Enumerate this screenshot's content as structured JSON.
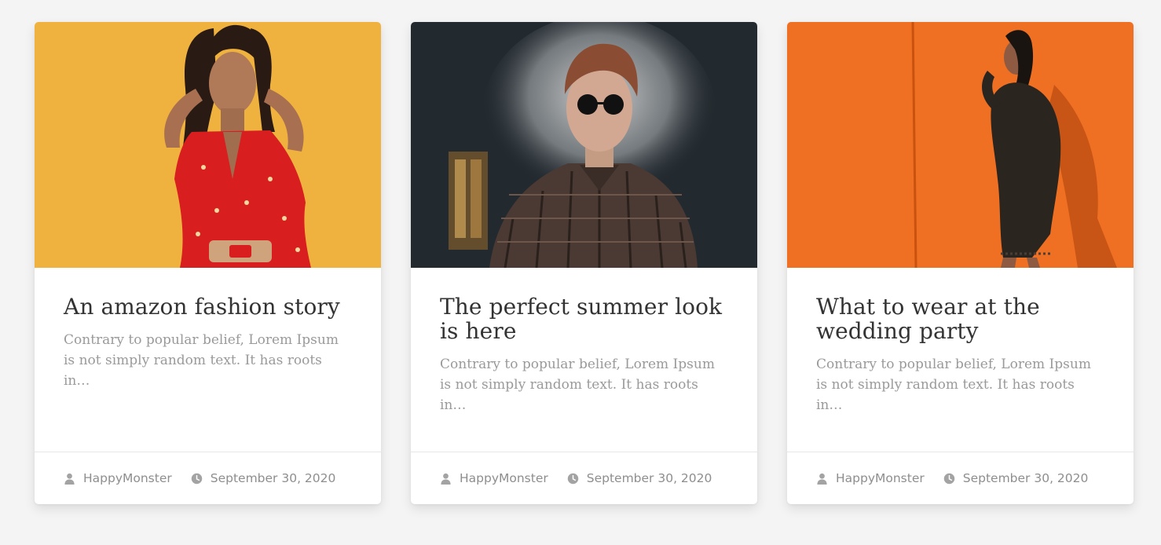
{
  "colors": {
    "page_background": "#f4f4f4",
    "card_background": "#ffffff",
    "title": "#333333",
    "excerpt": "#9a9a9a",
    "meta": "#8e8e8e"
  },
  "posts": [
    {
      "title": "An amazon fashion story",
      "excerpt": "Contrary to popular belief, Lorem Ipsum is not simply random text. It has roots in…",
      "author": "HappyMonster",
      "date": "September 30, 2020",
      "image_alt": "Woman in red floral dress on yellow background",
      "author_icon": "user-icon",
      "date_icon": "clock-icon"
    },
    {
      "title": "The perfect summer look is here",
      "excerpt": "Contrary to popular belief, Lorem Ipsum is not simply random text. It has roots in…",
      "author": "HappyMonster",
      "date": "September 30, 2020",
      "image_alt": "Man in sunglasses and plaid shirt surrounded by smoke",
      "author_icon": "user-icon",
      "date_icon": "clock-icon"
    },
    {
      "title": "What to wear at the wedding party",
      "excerpt": "Contrary to popular belief, Lorem Ipsum is not simply random text. It has roots in…",
      "author": "HappyMonster",
      "date": "September 30, 2020",
      "image_alt": "Woman in dark outfit against orange wall",
      "author_icon": "user-icon",
      "date_icon": "clock-icon"
    }
  ]
}
